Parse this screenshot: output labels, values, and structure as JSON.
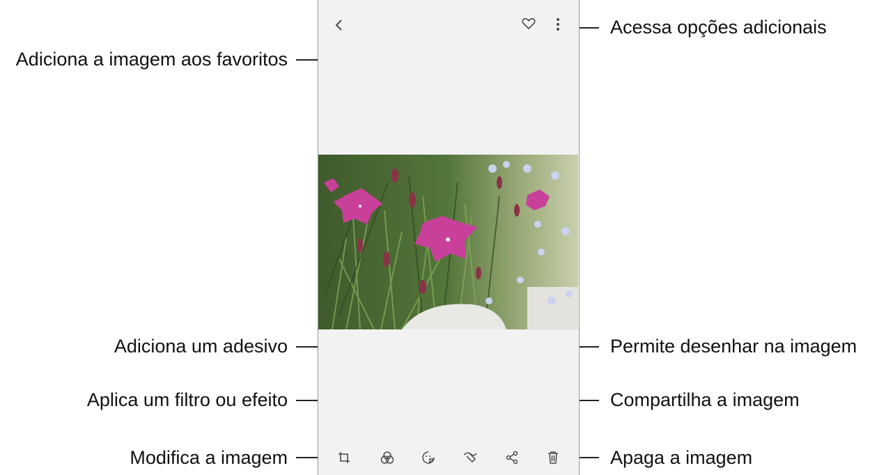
{
  "callouts": {
    "more_options": "Acessa opções adicionais",
    "favorite": "Adiciona a imagem aos favoritos",
    "sticker": "Adiciona um adesivo",
    "draw": "Permite desenhar na imagem",
    "filter": "Aplica um filtro ou efeito",
    "share": "Compartilha a imagem",
    "edit": "Modifica a imagem",
    "delete": "Apaga a imagem"
  },
  "top_bar": {
    "icons": [
      "back-icon",
      "heart-icon",
      "more-options-icon"
    ]
  },
  "bottom_toolbar": {
    "icons": [
      "edit-icon",
      "filter-icon",
      "sticker-icon",
      "draw-icon",
      "share-icon",
      "delete-icon"
    ]
  },
  "colors": {
    "phone_bg": "#f2f2f2",
    "icon": "#4a4a4a",
    "flower": "#c9409a",
    "leaf": "#4f7a3a"
  }
}
